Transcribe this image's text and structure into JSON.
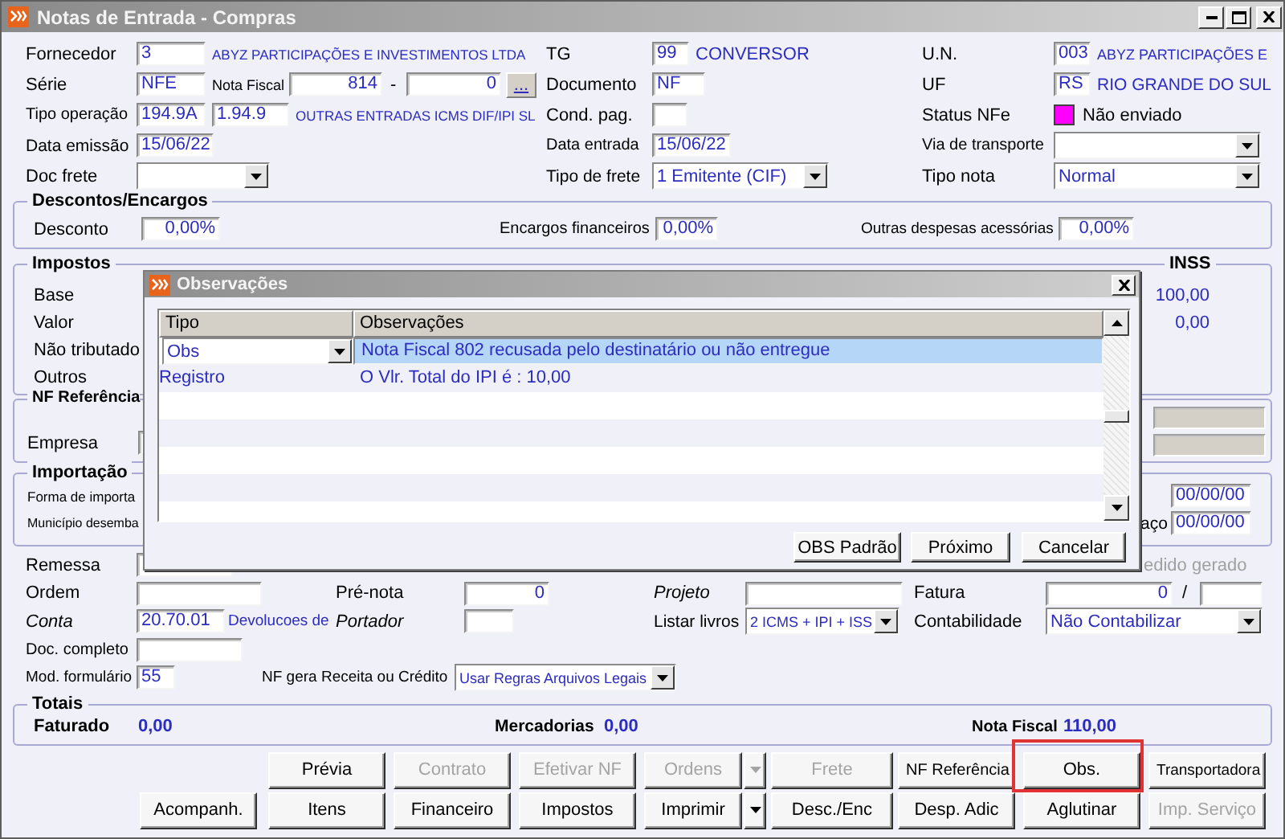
{
  "window": {
    "title": "Notas de Entrada - Compras"
  },
  "header_rows": [
    [
      {
        "kind": "label",
        "text": "Fornecedor"
      },
      {
        "kind": "input",
        "value": "3"
      },
      {
        "kind": "text",
        "text": "ABYZ PARTICIPAÇÕES E INVESTIMENTOS LTDA"
      },
      {
        "kind": "label",
        "text": "TG"
      },
      {
        "kind": "input",
        "value": "99"
      },
      {
        "kind": "text",
        "text": "CONVERSOR"
      },
      {
        "kind": "label",
        "text": "U.N."
      },
      {
        "kind": "input",
        "value": "003"
      },
      {
        "kind": "text",
        "text": "ABYZ PARTICIPAÇÕES E"
      }
    ],
    [
      {
        "kind": "label",
        "text": "Série"
      },
      {
        "kind": "input",
        "value": "NFE"
      },
      {
        "kind": "label",
        "text": "Nota Fiscal"
      },
      {
        "kind": "input",
        "value": "814"
      },
      {
        "kind": "label",
        "text": "-"
      },
      {
        "kind": "input",
        "value": "0"
      },
      {
        "kind": "button",
        "text": "..."
      },
      {
        "kind": "label",
        "text": "Documento"
      },
      {
        "kind": "input",
        "value": "NF"
      },
      {
        "kind": "label",
        "text": "UF"
      },
      {
        "kind": "input",
        "value": "RS"
      },
      {
        "kind": "text",
        "text": "RIO GRANDE DO SUL"
      }
    ],
    [
      {
        "kind": "label",
        "text": "Tipo operação"
      },
      {
        "kind": "input",
        "value": "194.9A"
      },
      {
        "kind": "input",
        "value": "1.94.9"
      },
      {
        "kind": "text",
        "text": "OUTRAS ENTRADAS ICMS DIF/IPI SL"
      },
      {
        "kind": "label",
        "text": "Cond. pag."
      },
      {
        "kind": "input"
      },
      {
        "kind": "label",
        "text": "Status NFe"
      },
      {
        "kind": "status",
        "color": "#ff00ff"
      },
      {
        "kind": "label",
        "text": "Não enviado"
      }
    ],
    [
      {
        "kind": "label",
        "text": "Data emissão"
      },
      {
        "kind": "input",
        "value": "15/06/22"
      },
      {
        "kind": "label",
        "text": "Data entrada"
      },
      {
        "kind": "input",
        "value": "15/06/22"
      },
      {
        "kind": "label",
        "text": "Via de transporte"
      },
      {
        "kind": "select"
      }
    ],
    [
      {
        "kind": "label",
        "text": "Doc frete"
      },
      {
        "kind": "select"
      },
      {
        "kind": "label",
        "text": "Tipo de frete"
      },
      {
        "kind": "select",
        "value": "1 Emitente (CIF)"
      },
      {
        "kind": "label",
        "text": "Tipo nota"
      },
      {
        "kind": "select",
        "value": "Normal"
      }
    ]
  ],
  "descontos": {
    "title": "Descontos/Encargos",
    "items": [
      {
        "kind": "label",
        "text": "Desconto"
      },
      {
        "kind": "input",
        "value": "0,00%"
      },
      {
        "kind": "label",
        "text": "Encargos financeiros"
      },
      {
        "kind": "input",
        "value": "0,00%"
      },
      {
        "kind": "label",
        "text": "Outras despesas acessórias"
      },
      {
        "kind": "input",
        "value": "0,00%"
      }
    ]
  },
  "impostos": {
    "title": "Impostos",
    "inss_heading": "INSS",
    "rows": [
      {
        "label": "Base",
        "inss": "100,00"
      },
      {
        "label": "Valor",
        "inss": "0,00"
      },
      {
        "label": "Não tributado"
      },
      {
        "label": "Outros"
      }
    ]
  },
  "nf_referencia": {
    "title": "NF Referência",
    "label": "Empresa",
    "side_fields": [
      {
        "disabled": true
      },
      {
        "disabled": true
      }
    ]
  },
  "importacao": {
    "title": "Importação",
    "rows": [
      {
        "label": "Forma de importa",
        "date": "00/00/00"
      },
      {
        "label": "Município desemba",
        "side_label": "aço",
        "date": "00/00/00"
      }
    ]
  },
  "lower_rows": [
    [
      {
        "kind": "label",
        "text": "Remessa"
      },
      {
        "kind": "input"
      },
      {
        "kind": "note",
        "text": "edido gerado",
        "disabled": true
      }
    ],
    [
      {
        "kind": "label",
        "text": "Ordem"
      },
      {
        "kind": "input"
      },
      {
        "kind": "label",
        "text": "Pré-nota"
      },
      {
        "kind": "input",
        "value": "0"
      },
      {
        "kind": "label",
        "text": "Projeto"
      },
      {
        "kind": "input"
      },
      {
        "kind": "label",
        "text": "Fatura"
      },
      {
        "kind": "input",
        "value": "0"
      },
      {
        "kind": "label",
        "text": "/"
      },
      {
        "kind": "input"
      }
    ],
    [
      {
        "kind": "label",
        "text": "Conta"
      },
      {
        "kind": "input",
        "value": "20.70.01"
      },
      {
        "kind": "text",
        "text": "Devolucoes de"
      },
      {
        "kind": "label",
        "text": "Portador"
      },
      {
        "kind": "input"
      },
      {
        "kind": "label",
        "text": "Listar livros"
      },
      {
        "kind": "select",
        "value": "2 ICMS + IPI + ISS"
      },
      {
        "kind": "label",
        "text": "Contabilidade"
      },
      {
        "kind": "select",
        "value": "Não Contabilizar"
      }
    ],
    [
      {
        "kind": "label",
        "text": "Doc. completo"
      },
      {
        "kind": "input"
      }
    ],
    [
      {
        "kind": "label",
        "text": "Mod. formulário"
      },
      {
        "kind": "input",
        "value": "55"
      },
      {
        "kind": "label",
        "text": "NF gera Receita ou Crédito"
      },
      {
        "kind": "select",
        "value": "Usar Regras Arquivos Legais"
      }
    ]
  ],
  "totais": {
    "title": "Totais",
    "items": [
      {
        "label": "Faturado",
        "value": "0,00"
      },
      {
        "label": "Mercadorias",
        "value": "0,00"
      },
      {
        "label": "Nota Fiscal",
        "value": "110,00"
      }
    ]
  },
  "buttons": [
    [
      {
        "text": "Prévia",
        "disabled": false,
        "dropdown": false,
        "highlighted": false
      },
      {
        "text": "Contrato",
        "disabled": true,
        "dropdown": false,
        "highlighted": false
      },
      {
        "text": "Efetivar NF",
        "disabled": true,
        "dropdown": false,
        "highlighted": false
      },
      {
        "text": "Ordens",
        "disabled": true,
        "dropdown": true,
        "highlighted": false
      },
      {
        "text": "Frete",
        "disabled": true,
        "dropdown": false,
        "highlighted": false
      },
      {
        "text": "NF Referência",
        "disabled": false,
        "dropdown": false,
        "highlighted": false
      },
      {
        "text": "Obs.",
        "disabled": false,
        "dropdown": false,
        "highlighted": true
      },
      {
        "text": "Transportadora",
        "disabled": false,
        "dropdown": false,
        "highlighted": false
      }
    ],
    [
      {
        "text": "Acompanh.",
        "disabled": false,
        "dropdown": false,
        "highlighted": false
      },
      {
        "text": "Itens",
        "disabled": false,
        "dropdown": false,
        "highlighted": false
      },
      {
        "text": "Financeiro",
        "disabled": false,
        "dropdown": false,
        "highlighted": false
      },
      {
        "text": "Impostos",
        "disabled": false,
        "dropdown": false,
        "highlighted": false
      },
      {
        "text": "Imprimir",
        "disabled": false,
        "dropdown": true,
        "highlighted": false
      },
      {
        "text": "Desc./Enc",
        "disabled": false,
        "dropdown": false,
        "highlighted": false
      },
      {
        "text": "Desp. Adic",
        "disabled": false,
        "dropdown": false,
        "highlighted": false
      },
      {
        "text": "Aglutinar",
        "disabled": false,
        "dropdown": false,
        "highlighted": false
      },
      {
        "text": "Imp. Serviço",
        "disabled": true,
        "dropdown": false,
        "highlighted": false
      }
    ]
  ],
  "dialog": {
    "title": "Observações",
    "columns": [
      "Tipo",
      "Observações"
    ],
    "rows": [
      {
        "tipo": "Obs",
        "observacao": "Nota Fiscal 802 recusada pelo destinatário ou não entregue",
        "selected": true,
        "editing": true
      },
      {
        "tipo": "Registro",
        "observacao": "O Vlr. Total do IPI é : 10,00",
        "selected": false,
        "editing": false
      }
    ],
    "buttons": [
      "OBS Padrão",
      "Próximo",
      "Cancelar"
    ]
  }
}
